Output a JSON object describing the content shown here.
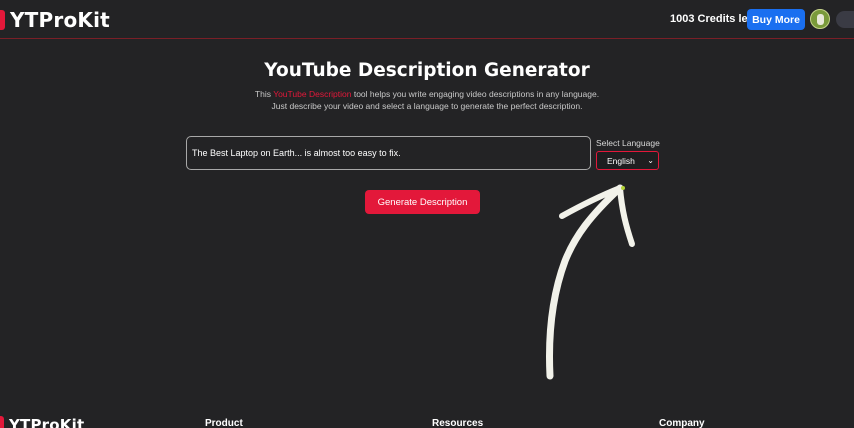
{
  "header": {
    "logo_text": "YTProKit",
    "credits": "1003 Credits left",
    "buy_label": "Buy More"
  },
  "main": {
    "title": "YouTube Description Generator",
    "desc_prefix": "This ",
    "desc_link": "YouTube Description",
    "desc_suffix": " tool helps you write engaging video descriptions in any language.",
    "desc_line2": "Just describe your video and select a language to generate the perfect description.",
    "input_value": "The Best Laptop on Earth... is almost too easy to fix.",
    "language_label": "Select Language",
    "language_selected": "English",
    "generate_label": "Generate Description"
  },
  "footer": {
    "logo_text": "YTProKit",
    "columns": [
      "Product",
      "Resources",
      "Company"
    ]
  },
  "colors": {
    "accent": "#e3183a",
    "buy_button": "#1a6ff0",
    "background": "#232325"
  }
}
